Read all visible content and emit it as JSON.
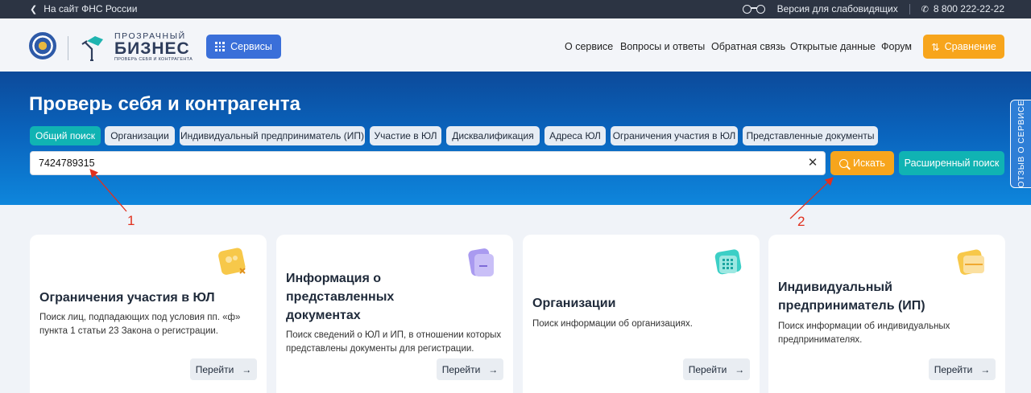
{
  "topbar": {
    "back_label": "На сайт ФНС России",
    "low_vision_label": "Версия для слабовидящих",
    "phone": "8 800 222-22-22"
  },
  "header": {
    "brand_line1": "ПРОЗРАЧНЫЙ",
    "brand_line2": "БИЗНЕС",
    "brand_line3": "ПРОВЕРЬ СЕБЯ И КОНТРАГЕНТА",
    "services_label": "Сервисы",
    "nav": [
      "О сервисе",
      "Вопросы и ответы",
      "Обратная связь",
      "Открытые данные",
      "Форум"
    ],
    "compare_label": "Сравнение"
  },
  "hero": {
    "title": "Проверь себя и контрагента",
    "tabs": [
      {
        "label": "Общий поиск",
        "active": true
      },
      {
        "label": "Организации",
        "active": false
      },
      {
        "label": "Индивидуальный предприниматель (ИП)",
        "active": false
      },
      {
        "label": "Участие в ЮЛ",
        "active": false
      },
      {
        "label": "Дисквалификация",
        "active": false
      },
      {
        "label": "Адреса ЮЛ",
        "active": false
      },
      {
        "label": "Ограничения участия в ЮЛ",
        "active": false
      },
      {
        "label": "Представленные документы",
        "active": false
      }
    ],
    "search_value": "7424789315",
    "search_button": "Искать",
    "advanced_button": "Расширенный поиск",
    "feedback_label": "ОТЗЫВ О СЕРВИСЕ"
  },
  "annotations": {
    "label1": "1",
    "label2": "2",
    "color": "#e0301e"
  },
  "cards": [
    {
      "title": "Ограничения участия в ЮЛ",
      "desc": "Поиск лиц, подпадающих под условия пп. «ф» пункта 1 статьи 23 Закона о регистрации.",
      "button": "Перейти",
      "icon": "restriction-icon"
    },
    {
      "title": "Информация о представленных документах",
      "desc": "Поиск сведений о ЮЛ и ИП, в отношении которых представлены документы для регистрации.",
      "button": "Перейти",
      "icon": "documents-icon"
    },
    {
      "title": "Организации",
      "desc": "Поиск информации об организациях.",
      "button": "Перейти",
      "icon": "organization-icon"
    },
    {
      "title": "Индивидуальный предприниматель (ИП)",
      "desc": "Поиск информации об индивидуальных предпринимателях.",
      "button": "Перейти",
      "icon": "entrepreneur-icon"
    }
  ],
  "colors": {
    "accent_teal": "#10b3b3",
    "accent_orange": "#f7a51c",
    "accent_blue": "#3a6fd9",
    "topbar": "#2c3443"
  }
}
